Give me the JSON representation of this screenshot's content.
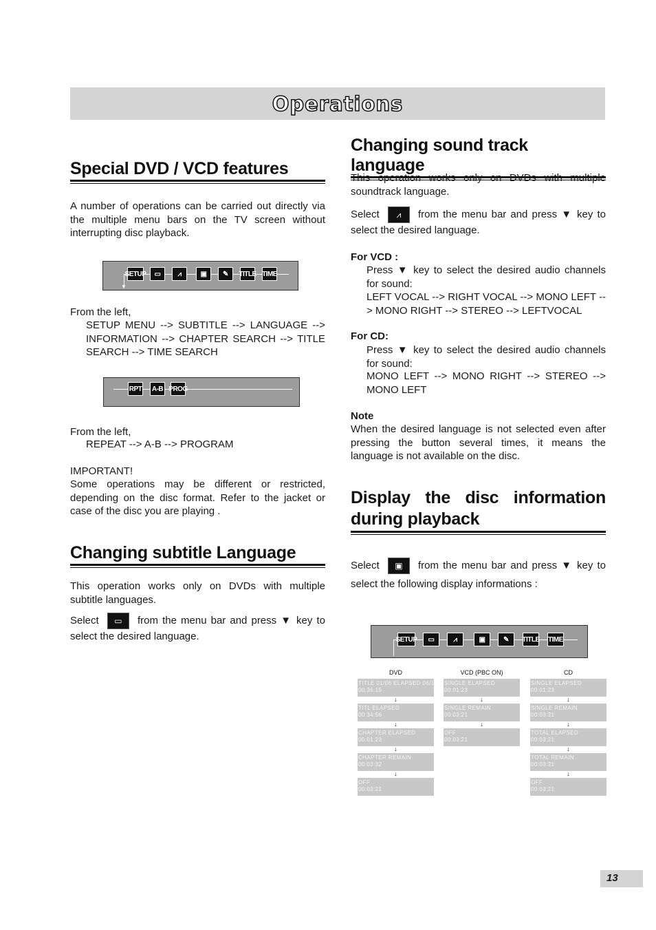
{
  "header": {
    "title": "Operations"
  },
  "special": {
    "heading": "Special DVD / VCD features",
    "intro": "A number of operations can be carried out directly via the multiple menu bars on the TV screen without interrupting disc playback.",
    "bar1": [
      "SETUP",
      "[...]",
      "LANG",
      "INFO",
      "CHAP",
      "TITLE",
      "TIME"
    ],
    "from1": "From the left,",
    "list1": "SETUP MENU --> SUBTITLE --> LANGUAGE --> INFORMATION --> CHAPTER SEARCH --> TITLE SEARCH --> TIME SEARCH",
    "bar2": [
      "RPT",
      "A-B",
      "PROG"
    ],
    "from2": "From the left,",
    "list2": "REPEAT --> A-B --> PROGRAM",
    "important_label": "IMPORTANT!",
    "important": "Some operations may be different or restricted, depending on the disc format. Refer to the jacket or case of the disc you are playing ."
  },
  "subtitle": {
    "heading": "Changing subtitle Language",
    "intro": "This operation works only on DVDs with multiple subtitle languages.",
    "select_a": "Select",
    "select_b": "from the menu bar and press ▼ key to select the desired language."
  },
  "sound": {
    "heading": "Changing sound track language",
    "intro": "This operation works only on DVDs with multiple soundtrack language.",
    "select_a": "Select",
    "select_b": "from the menu bar and press ▼ key to select the desired language.",
    "vcd_label": "For VCD :",
    "vcd_text": "Press ▼ key to select the desired audio channels for sound:",
    "vcd_seq": "LEFT VOCAL --> RIGHT VOCAL --> MONO LEFT --> MONO RIGHT --> STEREO --> LEFTVOCAL",
    "cd_label": "For CD:",
    "cd_text": "Press ▼ key to select the desired audio channels for sound:",
    "cd_seq": "MONO LEFT --> MONO RIGHT --> STEREO --> MONO LEFT",
    "note_label": "Note",
    "note": "When the desired language is not selected even after pressing the button several times, it means the language is not available on the disc."
  },
  "display": {
    "heading": "Display the disc information during playback",
    "select_a": "Select",
    "select_b": "from the menu bar and press ▼ key to select the following display informations :",
    "columns": [
      {
        "title": "DVD",
        "items": [
          [
            "TITLE 01/06 ELAPSED 06/19",
            "00:36:15"
          ],
          [
            "TITL ELAPSED",
            "00:34:56"
          ],
          [
            "CHAPTER ELAPSED",
            "00:01:23"
          ],
          [
            "CHAPTER REMAIN",
            "00:03:32"
          ],
          [
            "OFF",
            "00:03:21"
          ]
        ]
      },
      {
        "title": "VCD (PBC ON)",
        "items": [
          [
            "SINGLE ELAPSED",
            "00:01:23"
          ],
          [
            "SINGLE REMAIN",
            "00:03:21"
          ],
          [
            "OFF",
            "00:03:21"
          ]
        ]
      },
      {
        "title": "CD",
        "items": [
          [
            "SINGLE ELAPSED",
            "00:01:23"
          ],
          [
            "SINGLE REMAIN",
            "00:03:21"
          ],
          [
            "TOTAL ELAPSED",
            "00:03:21"
          ],
          [
            "TOTAL REMAIN",
            "00:03:21"
          ],
          [
            "OFF",
            "00:03:21"
          ]
        ]
      }
    ]
  },
  "page_number": "13"
}
